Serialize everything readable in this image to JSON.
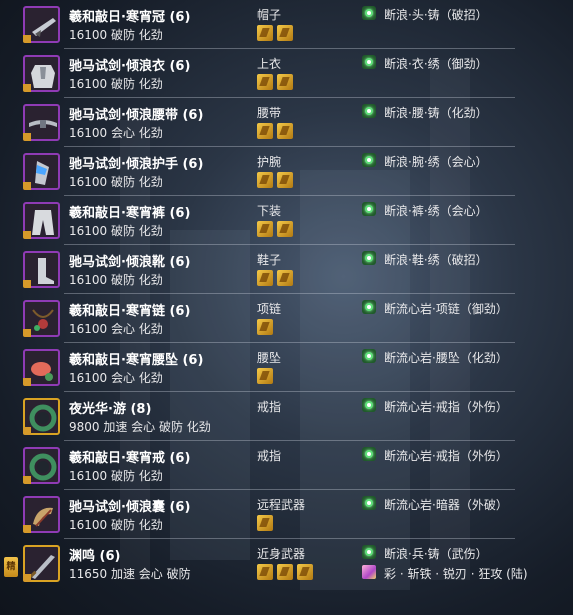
{
  "equipment": [
    {
      "name": "羲和敲日·寒宵冠 (6)",
      "stats": "16100 破防 化劲",
      "slot": "帽子",
      "sockets": 2,
      "enchant": "断浪·头·铸（破招）",
      "icon": "helmet-icon",
      "rarity": "purple"
    },
    {
      "name": "驰马试剑·倾浪衣 (6)",
      "stats": "16100 破防 化劲",
      "slot": "上衣",
      "sockets": 2,
      "enchant": "断浪·衣·绣（御劲）",
      "icon": "chest-armor-icon",
      "rarity": "purple"
    },
    {
      "name": "驰马试剑·倾浪腰带 (6)",
      "stats": "16100 会心 化劲",
      "slot": "腰带",
      "sockets": 2,
      "enchant": "断浪·腰·铸（化劲）",
      "icon": "belt-icon",
      "rarity": "purple"
    },
    {
      "name": "驰马试剑·倾浪护手 (6)",
      "stats": "16100 破防 化劲",
      "slot": "护腕",
      "sockets": 2,
      "enchant": "断浪·腕·绣（会心）",
      "icon": "bracer-icon",
      "rarity": "purple"
    },
    {
      "name": "羲和敲日·寒宵裤 (6)",
      "stats": "16100 破防 化劲",
      "slot": "下装",
      "sockets": 2,
      "enchant": "断浪·裤·绣（会心）",
      "icon": "pants-icon",
      "rarity": "purple"
    },
    {
      "name": "驰马试剑·倾浪靴 (6)",
      "stats": "16100 破防 化劲",
      "slot": "鞋子",
      "sockets": 2,
      "enchant": "断浪·鞋·绣（破招）",
      "icon": "boots-icon",
      "rarity": "purple"
    },
    {
      "name": "羲和敲日·寒宵链 (6)",
      "stats": "16100 会心 化劲",
      "slot": "项链",
      "sockets": 1,
      "enchant": "断流心岩·项链（御劲）",
      "icon": "necklace-icon",
      "rarity": "purple"
    },
    {
      "name": "羲和敲日·寒宵腰坠 (6)",
      "stats": "16100 会心 化劲",
      "slot": "腰坠",
      "sockets": 1,
      "enchant": "断流心岩·腰坠（化劲）",
      "icon": "pendant-icon",
      "rarity": "purple"
    },
    {
      "name": "夜光华·游 (8)",
      "stats": "9800 加速 会心 破防 化劲",
      "slot": "戒指",
      "sockets": 0,
      "enchant": "断流心岩·戒指（外伤）",
      "icon": "ring-icon",
      "rarity": "gold"
    },
    {
      "name": "羲和敲日·寒宵戒 (6)",
      "stats": "16100 破防 化劲",
      "slot": "戒指",
      "sockets": 0,
      "enchant": "断流心岩·戒指（外伤）",
      "icon": "ring-icon",
      "rarity": "purple"
    },
    {
      "name": "驰马试剑·倾浪囊 (6)",
      "stats": "16100 破防 化劲",
      "slot": "远程武器",
      "sockets": 1,
      "enchant": "断流心岩·暗器（外破）",
      "icon": "quiver-icon",
      "rarity": "purple"
    },
    {
      "name": "渊鸣 (6)",
      "stats": "11650 加速 会心 破防",
      "slot": "近身武器",
      "sockets": 3,
      "enchant": "断浪·兵·铸（武伤）",
      "extra_enchant": "彩 · 斩铁 · 锐刃 · 狂攻 (陆)",
      "icon": "weapon-icon",
      "rarity": "gold"
    }
  ],
  "weapon_badge": "精",
  "colors": {
    "purple_frame": "#8f3bb5",
    "gold_frame": "#d9a323",
    "socket": "#f4c948",
    "enchant": "#5fe07a"
  }
}
